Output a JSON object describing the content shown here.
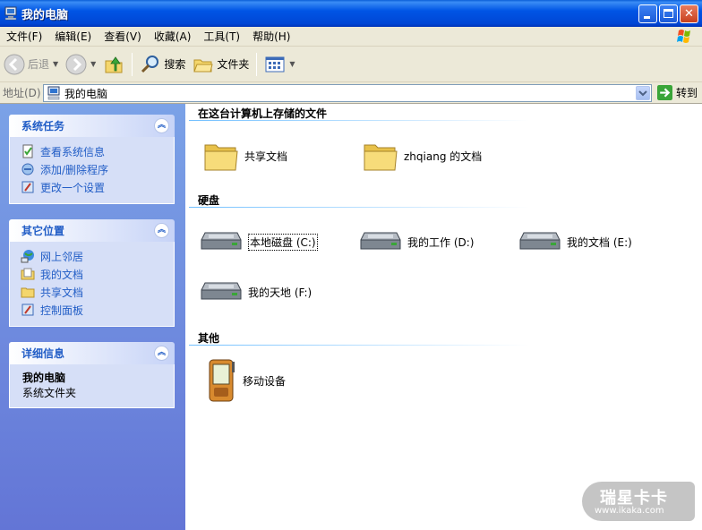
{
  "window": {
    "title": "我的电脑"
  },
  "menu": [
    "文件(F)",
    "编辑(E)",
    "查看(V)",
    "收藏(A)",
    "工具(T)",
    "帮助(H)"
  ],
  "toolbar": {
    "back_label": "后退",
    "search_label": "搜索",
    "folders_label": "文件夹"
  },
  "address": {
    "label": "地址(D)",
    "value": "我的电脑",
    "go_label": "转到"
  },
  "sidebar": {
    "system_tasks": {
      "title": "系统任务",
      "items": [
        "查看系统信息",
        "添加/删除程序",
        "更改一个设置"
      ]
    },
    "other_places": {
      "title": "其它位置",
      "items": [
        "网上邻居",
        "我的文档",
        "共享文档",
        "控制面板"
      ]
    },
    "details": {
      "title": "详细信息",
      "name": "我的电脑",
      "type": "系统文件夹"
    }
  },
  "main": {
    "stored_files": {
      "heading": "在这台计算机上存储的文件",
      "items": [
        "共享文档",
        "zhqiang 的文档"
      ]
    },
    "hard_disks": {
      "heading": "硬盘",
      "items": [
        "本地磁盘 (C:)",
        "我的工作 (D:)",
        "我的文档 (E:)",
        "我的天地 (F:)"
      ]
    },
    "other": {
      "heading": "其他",
      "items": [
        "移动设备"
      ]
    }
  },
  "watermark": {
    "title": "瑞星卡卡",
    "url": "www.ikaka.com"
  },
  "colors": {
    "title_bar": "#0054e3",
    "task_pane": "#6375d6",
    "link": "#215dc6"
  }
}
